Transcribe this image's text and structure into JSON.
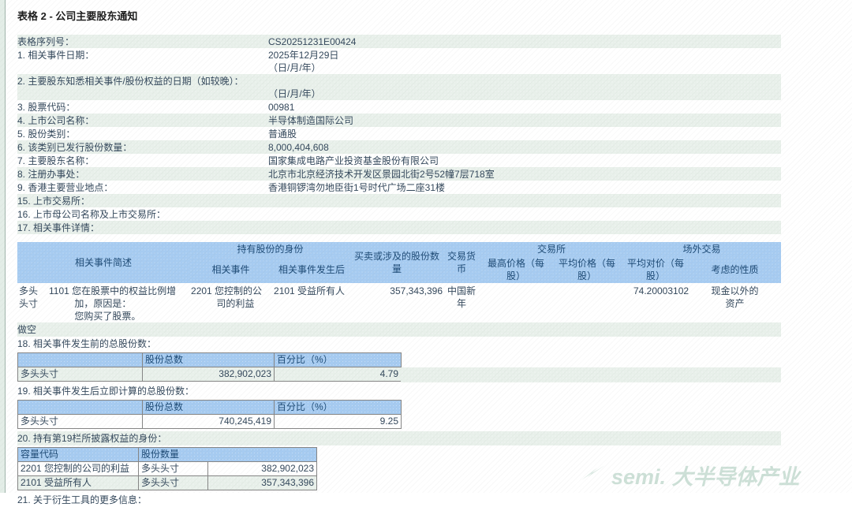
{
  "page": {
    "title": "表格 2 - 公司主要股东通知"
  },
  "colors": {
    "header_blue": "#a6cbf1",
    "row_green": "#e8f0ea",
    "border_gray": "#858585",
    "text": "#33475b"
  },
  "fields": [
    {
      "label": "表格序列号：",
      "v1": "CS20251231E00424"
    },
    {
      "label": "1. 相关事件日期：",
      "v1": "2025年12月29日",
      "v2": "（日/月/年）"
    },
    {
      "label": "2. 主要股东知悉相关事件/股份权益的日期（如较晚）：",
      "v1": "",
      "v2": "（日/月/年）"
    },
    {
      "label": "3. 股票代码：",
      "v1": "00981"
    },
    {
      "label": "4. 上市公司名称：",
      "v1": "半导体制造国际公司"
    },
    {
      "label": "5. 股份类别：",
      "v1": "普通股"
    },
    {
      "label": "6. 该类别已发行股份数量：",
      "v1": "8,000,404,608"
    },
    {
      "label": "7. 主要股东名称：",
      "v1": "国家集成电路产业投资基金股份有限公司"
    },
    {
      "label": "8. 注册办事处：",
      "v1": "北京市北京经济技术开发区景园北街2号52幢7层718室"
    },
    {
      "label": "9. 香港主要营业地点：",
      "v1": "香港铜锣湾勿地臣街1号时代广场二座31楼"
    },
    {
      "label": "15. 上市交易所：",
      "v1": ""
    },
    {
      "label": "16. 上市母公司名称及上市交易所：",
      "v1": ""
    },
    {
      "label": "17. 相关事件详情：",
      "v1": ""
    }
  ],
  "event_table": {
    "headers": {
      "event_desc": "相关事件简述",
      "capacity_group": "持有股份的身份",
      "capacity_event": "相关事件",
      "capacity_after": "相关事件发生后",
      "shares_number": "买卖或涉及的股份数量",
      "currency": "交易货币",
      "on_exchange_group": "交易所",
      "highest_price": "最高价格（每股）",
      "avg_price": "平均价格（每股）",
      "off_exchange_group": "场外交易",
      "avg_consideration": "平均对价（每股）",
      "nature": "考虑的性质"
    },
    "long_row": {
      "position": "多头头寸",
      "event_desc": "1101 您在股票中的权益比例增加，原因是：\n您购买了股票。",
      "capacity_event": "2201 您控制的公司的利益",
      "capacity_after": "2101 受益所有人",
      "shares_number": "357,343,396",
      "currency": "中国新年",
      "highest_price": "",
      "avg_price": "",
      "avg_consideration": "74.20003102",
      "nature": "现金以外的资产"
    },
    "short_row_label": "做空"
  },
  "section18": {
    "title": "18. 相关事件发生前的总股份数：",
    "col_shares": "股份总数",
    "col_pct": "百分比（%）",
    "row_label": "多头头寸",
    "shares": "382,902,023",
    "pct": "4.79"
  },
  "section19": {
    "title": "19. 相关事件发生后立即计算的总股份数：",
    "col_shares": "股份总数",
    "col_pct": "百分比（%）",
    "row_label": "多头头寸",
    "shares": "740,245,419",
    "pct": "9.25"
  },
  "section20": {
    "title": "20. 持有第19栏所披露权益的身份：",
    "col_capacity": "容量代码",
    "col_shares": "股份数量",
    "rows": [
      {
        "capacity": "2201 您控制的公司的利益",
        "position": "多头头寸",
        "shares": "382,902,023"
      },
      {
        "capacity": "2101 受益所有人",
        "position": "多头头寸",
        "shares": "357,343,396"
      }
    ]
  },
  "section21": {
    "title": "21. 关于衍生工具的更多信息："
  },
  "watermark": {
    "text": "semi. 大半导体产业"
  }
}
